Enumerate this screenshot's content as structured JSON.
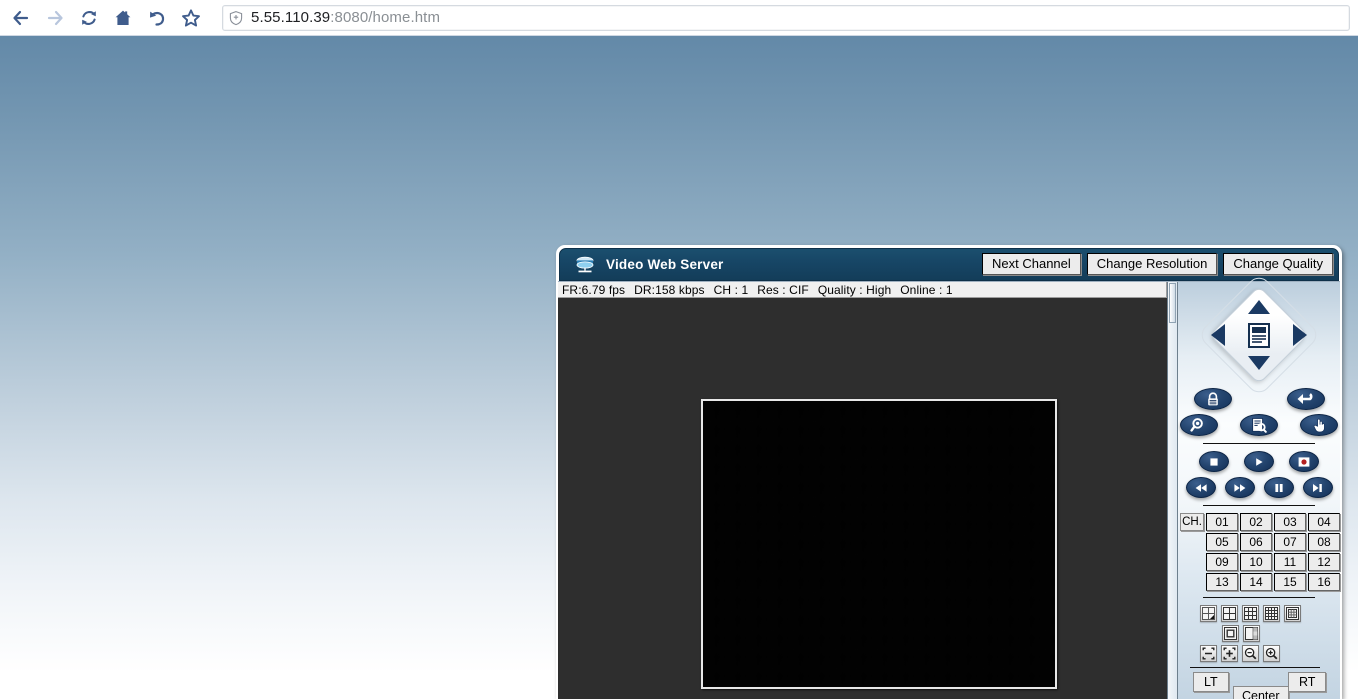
{
  "browser": {
    "nav_icons": [
      "back-icon",
      "forward-icon",
      "reload-icon",
      "home-icon",
      "undo-icon",
      "bookmark-star-icon"
    ],
    "url_host": "5.55.110.39",
    "url_rest": ":8080/home.htm",
    "security_icon": "shield-icon"
  },
  "app": {
    "title": "Video Web Server",
    "logo_icon": "server-device-icon",
    "header_buttons": [
      {
        "label": "Next Channel",
        "name": "next-channel-button"
      },
      {
        "label": "Change Resolution",
        "name": "change-resolution-button"
      },
      {
        "label": "Change Quality",
        "name": "change-quality-button"
      }
    ],
    "status": {
      "fps": "FR:6.79 fps",
      "bitrate": "DR:158 kbps",
      "channel": "CH : 1",
      "resolution": "Res : CIF",
      "quality": "Quality : High",
      "online": "Online : 1"
    },
    "ptz": {
      "up": "dpad-up-arrow",
      "down": "dpad-down-arrow",
      "left": "dpad-left-arrow",
      "right": "dpad-right-arrow",
      "center": "dpad-center-menu-icon"
    },
    "function_buttons": [
      {
        "name": "lock-button",
        "icon": "lock-icon"
      },
      {
        "name": "back-return-button",
        "icon": "return-arrow-icon"
      },
      {
        "name": "zoom-search-button",
        "icon": "magnifier-icon"
      },
      {
        "name": "document-search-button",
        "icon": "document-search-icon"
      },
      {
        "name": "hand-pointer-button",
        "icon": "hand-pointer-icon"
      }
    ],
    "playback_buttons": [
      {
        "name": "stop-button",
        "icon": "stop-icon"
      },
      {
        "name": "play-button",
        "icon": "play-icon"
      },
      {
        "name": "record-button",
        "icon": "record-icon"
      },
      {
        "name": "rewind-button",
        "icon": "rewind-icon"
      },
      {
        "name": "fast-forward-button",
        "icon": "fast-forward-icon"
      },
      {
        "name": "pause-button",
        "icon": "pause-icon"
      },
      {
        "name": "step-forward-button",
        "icon": "step-forward-icon"
      }
    ],
    "channel_label": "CH.",
    "channels": [
      "01",
      "02",
      "03",
      "04",
      "05",
      "06",
      "07",
      "08",
      "09",
      "10",
      "11",
      "12",
      "13",
      "14",
      "15",
      "16"
    ],
    "layout_icons_row1": [
      "layout-single-icon",
      "layout-quad-icon",
      "layout-9-grid-icon",
      "layout-16-grid-icon",
      "layout-pip-grid-icon"
    ],
    "layout_icons_row2": [
      "layout-center-frame-icon",
      "layout-split-sidebar-icon"
    ],
    "zoom_icons_row3": [
      "fit-screen-icon",
      "full-screen-icon",
      "zoom-out-icon",
      "zoom-in-icon"
    ],
    "position_buttons": [
      {
        "label": "LT",
        "name": "position-left-top-button"
      },
      {
        "label": "Center",
        "name": "position-center-button"
      },
      {
        "label": "RT",
        "name": "position-right-top-button"
      }
    ]
  },
  "colors": {
    "titlebar": "#16466a",
    "accent_button": "#1b3a63",
    "page_gradient_top": "#6389a8",
    "video_background": "#2e2e2e"
  }
}
